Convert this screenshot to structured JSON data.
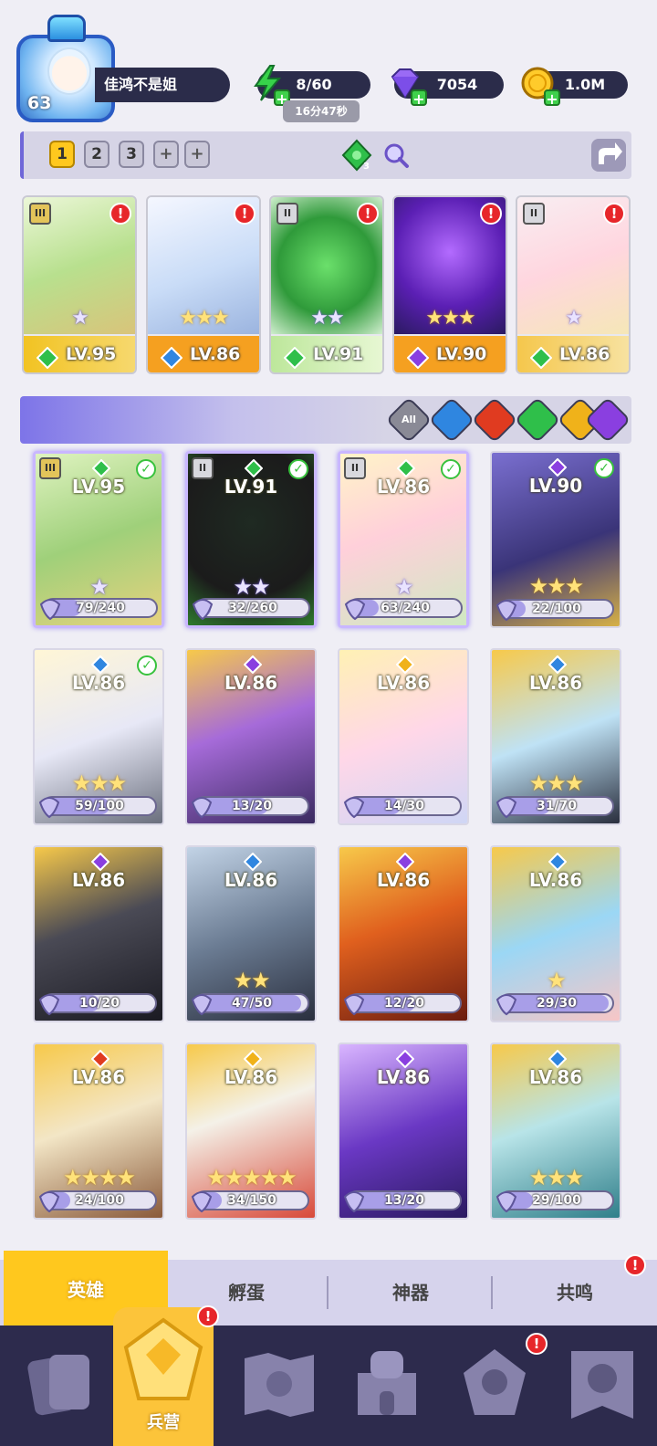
{
  "player": {
    "level": "63",
    "name": "佳鸿不是姐"
  },
  "resources": {
    "energy": "8/60",
    "energy_timer": "16分47秒",
    "gems": "7054",
    "gold": "1.0M"
  },
  "teambar": {
    "tabs": [
      "1",
      "2",
      "3",
      "+",
      "+"
    ],
    "active_tab": "1",
    "gem_count": "3"
  },
  "team_slots": [
    {
      "level": "LV.95",
      "element": "wind",
      "stars": 1,
      "rank": "III",
      "alert": "!"
    },
    {
      "level": "LV.86",
      "element": "water",
      "stars": 3,
      "rank": "",
      "alert": "!"
    },
    {
      "level": "LV.91",
      "element": "wind",
      "stars": 2,
      "rank": "II",
      "alert": "!"
    },
    {
      "level": "LV.90",
      "element": "dark",
      "stars": 3,
      "rank": "",
      "alert": "!"
    },
    {
      "level": "LV.86",
      "element": "wind",
      "stars": 1,
      "rank": "II",
      "alert": "!"
    }
  ],
  "filters": [
    "All",
    "water",
    "fire",
    "wind",
    "light",
    "dark"
  ],
  "filter_all_label": "All",
  "heroes": [
    {
      "level": "LV.95",
      "element": "wind",
      "progress": "79/240",
      "fraction": 0.33,
      "stars": 1,
      "gold_stars": false,
      "checked": true,
      "rank": "III",
      "selected": true
    },
    {
      "level": "LV.91",
      "element": "wind",
      "progress": "32/260",
      "fraction": 0.12,
      "stars": 2,
      "gold_stars": false,
      "checked": true,
      "rank": "II",
      "selected": true
    },
    {
      "level": "LV.86",
      "element": "wind",
      "progress": "63/240",
      "fraction": 0.26,
      "stars": 1,
      "gold_stars": false,
      "checked": true,
      "rank": "II",
      "selected": true
    },
    {
      "level": "LV.90",
      "element": "dark",
      "progress": "22/100",
      "fraction": 0.22,
      "stars": 3,
      "gold_stars": true,
      "checked": true,
      "rank": "",
      "selected": false
    },
    {
      "level": "LV.86",
      "element": "water",
      "progress": "59/100",
      "fraction": 0.59,
      "stars": 3,
      "gold_stars": true,
      "checked": true,
      "rank": "",
      "selected": false
    },
    {
      "level": "LV.86",
      "element": "dark",
      "progress": "13/20",
      "fraction": 0.65,
      "stars": 0,
      "gold_stars": true,
      "checked": false,
      "rank": "",
      "selected": false
    },
    {
      "level": "LV.86",
      "element": "light",
      "progress": "14/30",
      "fraction": 0.47,
      "stars": 0,
      "gold_stars": true,
      "checked": false,
      "rank": "",
      "selected": false
    },
    {
      "level": "LV.86",
      "element": "water",
      "progress": "31/70",
      "fraction": 0.44,
      "stars": 3,
      "gold_stars": true,
      "checked": false,
      "rank": "",
      "selected": false
    },
    {
      "level": "LV.86",
      "element": "dark",
      "progress": "10/20",
      "fraction": 0.5,
      "stars": 0,
      "gold_stars": true,
      "checked": false,
      "rank": "",
      "selected": false
    },
    {
      "level": "LV.86",
      "element": "water",
      "progress": "47/50",
      "fraction": 0.94,
      "stars": 2,
      "gold_stars": true,
      "checked": false,
      "rank": "",
      "selected": false
    },
    {
      "level": "LV.86",
      "element": "dark",
      "progress": "12/20",
      "fraction": 0.6,
      "stars": 0,
      "gold_stars": true,
      "checked": false,
      "rank": "",
      "selected": false
    },
    {
      "level": "LV.86",
      "element": "water",
      "progress": "29/30",
      "fraction": 0.97,
      "stars": 1,
      "gold_stars": true,
      "checked": false,
      "rank": "",
      "selected": false
    },
    {
      "level": "LV.86",
      "element": "fire",
      "progress": "24/100",
      "fraction": 0.24,
      "stars": 4,
      "gold_stars": true,
      "checked": false,
      "rank": "",
      "selected": false
    },
    {
      "level": "LV.86",
      "element": "light",
      "progress": "34/150",
      "fraction": 0.23,
      "stars": 5,
      "gold_stars": true,
      "checked": false,
      "rank": "",
      "selected": false
    },
    {
      "level": "LV.86",
      "element": "dark",
      "progress": "13/20",
      "fraction": 0.65,
      "stars": 0,
      "gold_stars": true,
      "checked": false,
      "rank": "",
      "selected": false
    },
    {
      "level": "LV.86",
      "element": "water",
      "progress": "29/100",
      "fraction": 0.29,
      "stars": 3,
      "gold_stars": true,
      "checked": false,
      "rank": "",
      "selected": false
    }
  ],
  "subtabs": [
    {
      "label": "英雄",
      "active": true,
      "alert": ""
    },
    {
      "label": "孵蛋",
      "active": false,
      "alert": ""
    },
    {
      "label": "神器",
      "active": false,
      "alert": ""
    },
    {
      "label": "共鸣",
      "active": false,
      "alert": "!"
    }
  ],
  "nav": {
    "active_label": "兵营",
    "items": [
      "cards-icon",
      "barracks-icon",
      "map-icon",
      "castle-icon",
      "guild-icon",
      "banner-icon"
    ]
  },
  "colors": {
    "wind": "#2fbf4a",
    "water": "#2f86e0",
    "fire": "#e03b20",
    "light": "#f0b21a",
    "dark": "#8a3fe0",
    "accent_gold": "#ffc81e",
    "nav_bg": "#2d2b4d"
  }
}
